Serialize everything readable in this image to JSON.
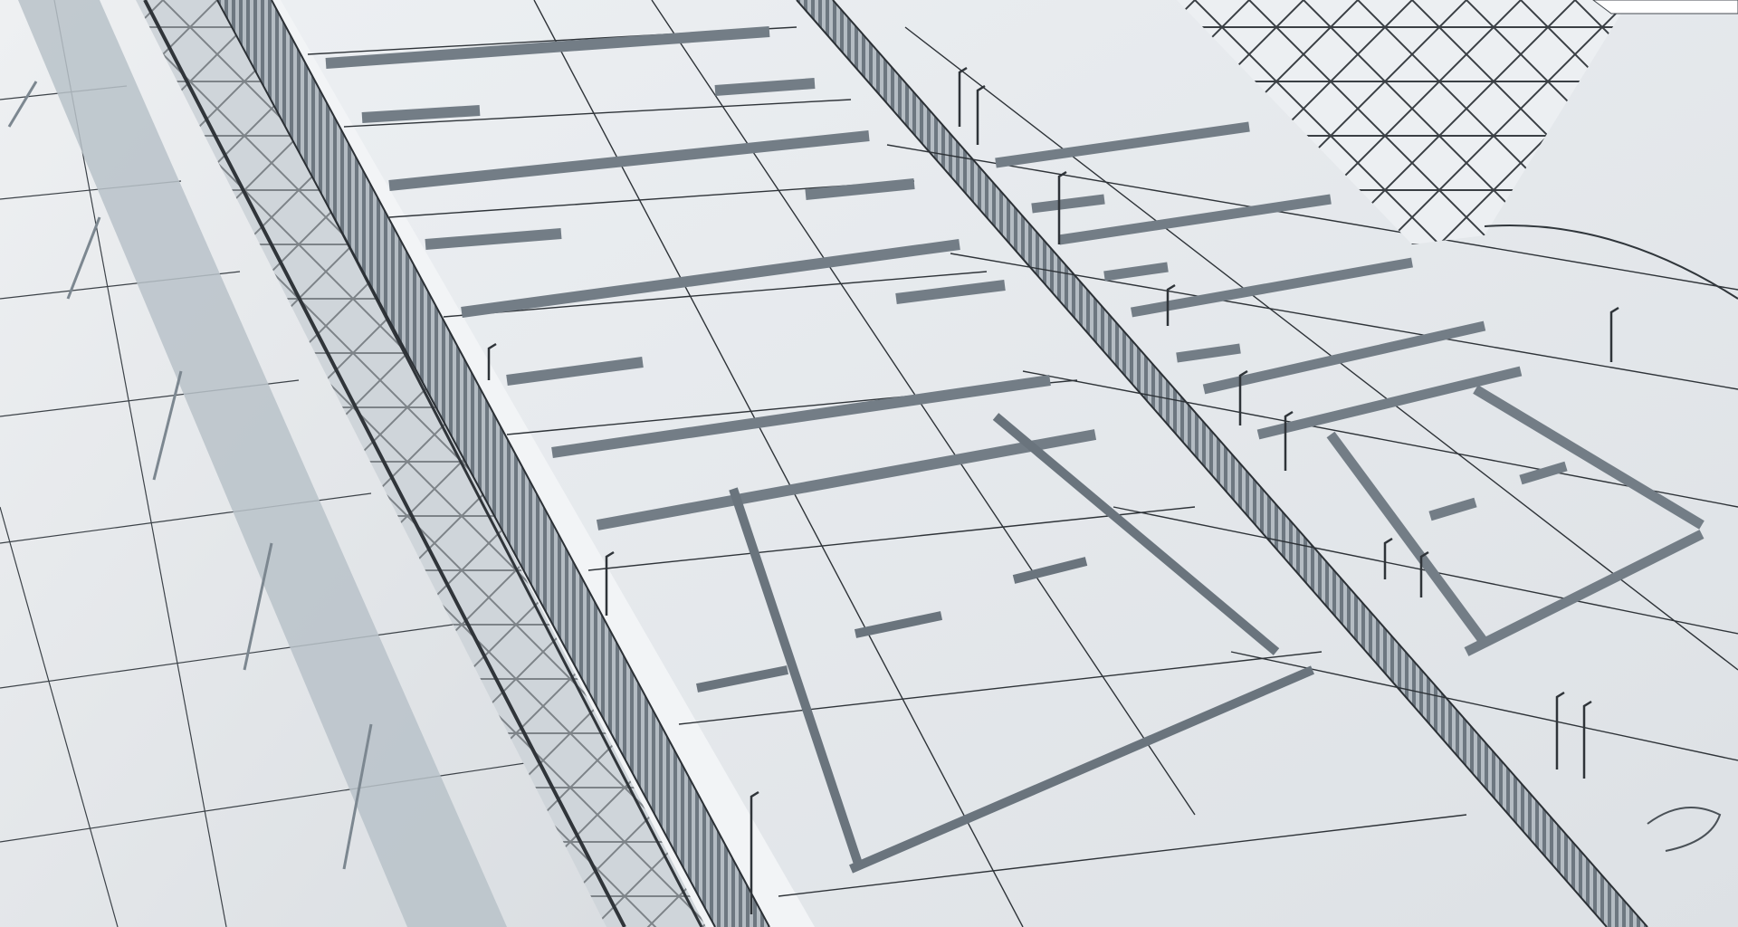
{
  "scene": {
    "subject": "stadium-render",
    "palette": {
      "roof": "#e6e9ec",
      "roof_grid": "#2c3034",
      "shadow": "#8d99a3",
      "ground": "#dfe3e7",
      "steel": "#3a3f44",
      "sky": "#f4f6f8",
      "mast": "#ffffff"
    }
  }
}
